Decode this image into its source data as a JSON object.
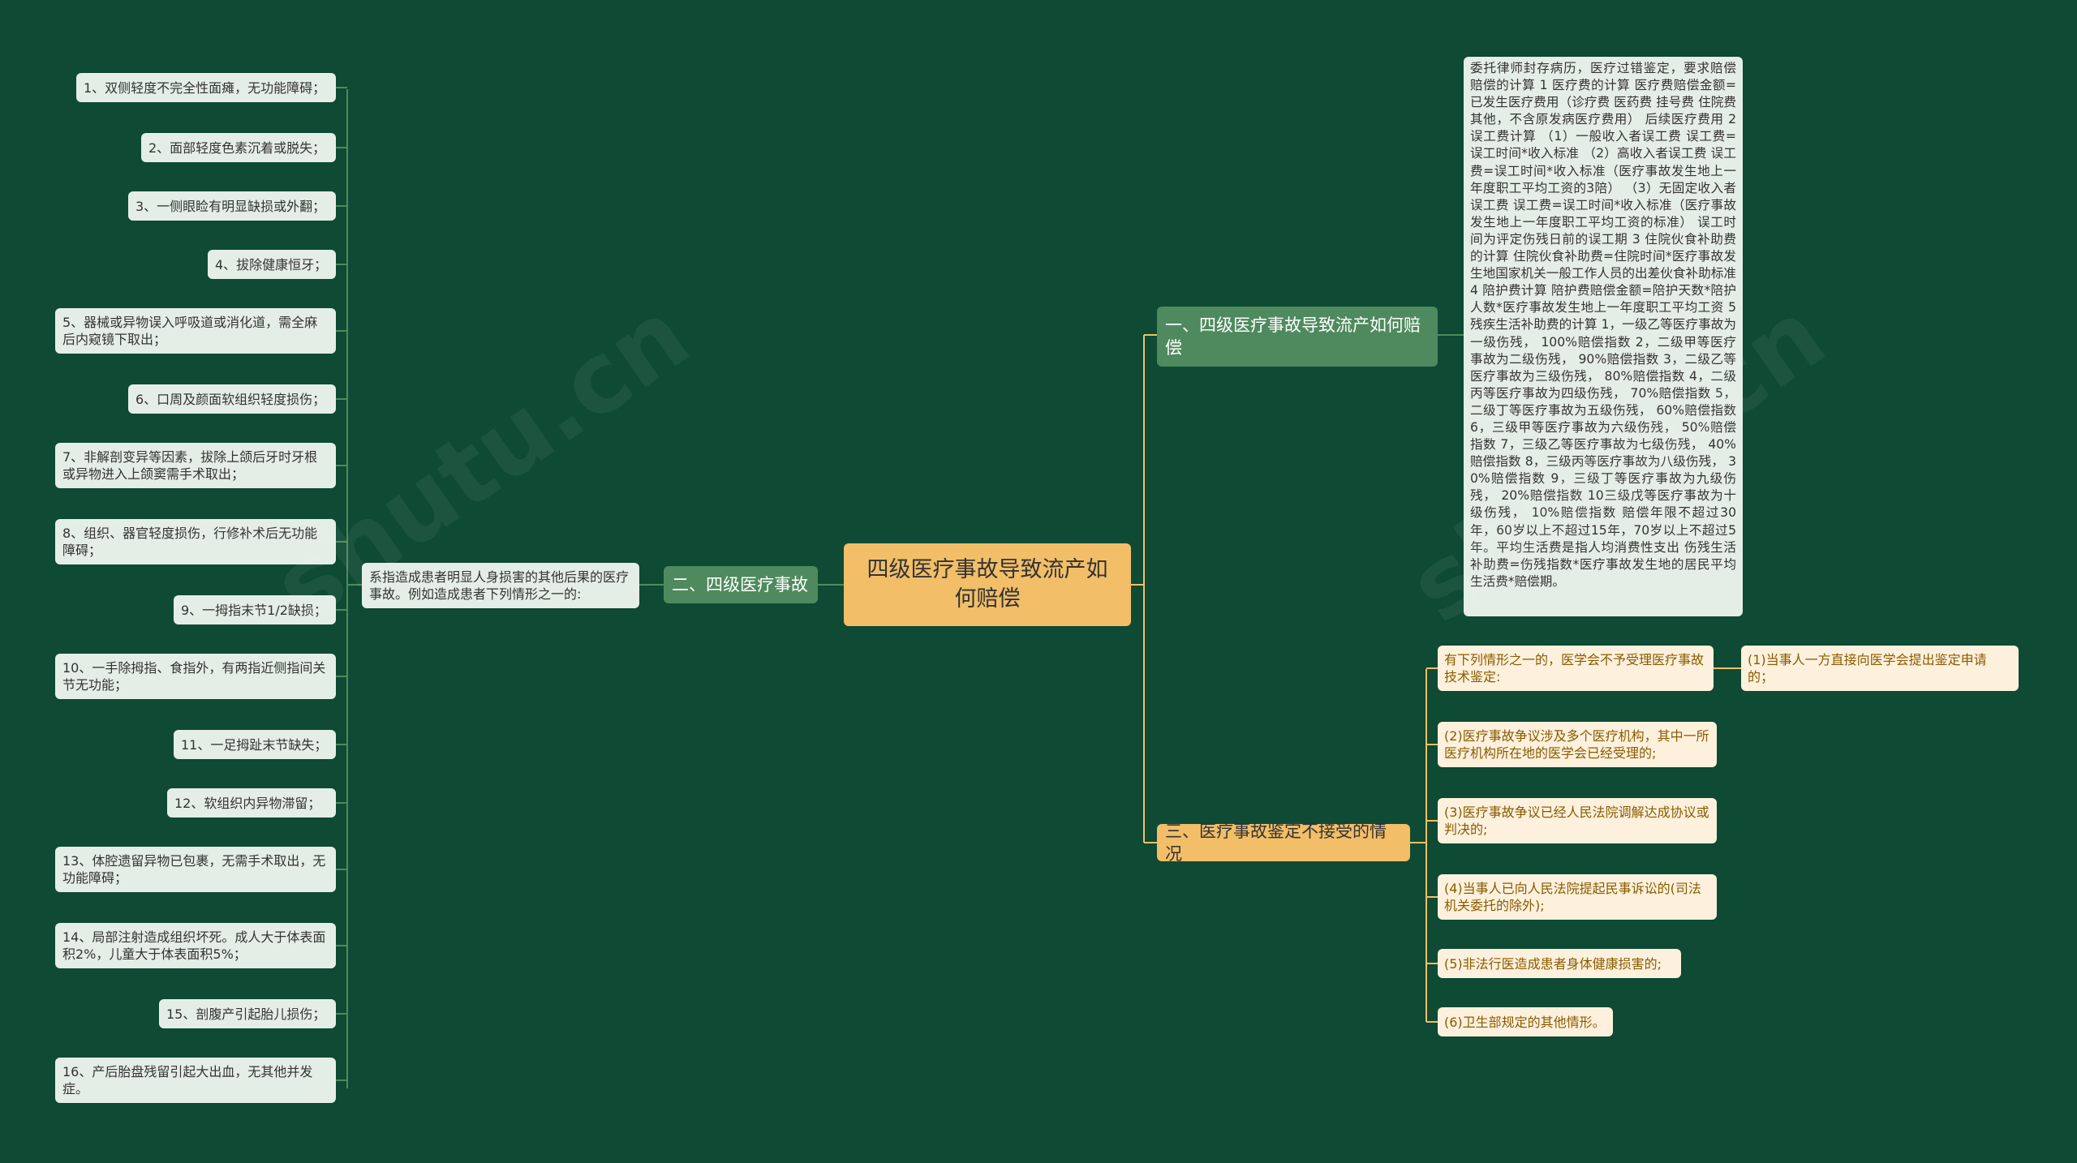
{
  "root": "四级医疗事故导致流产如何赔偿",
  "branch1": {
    "title": "一、四级医疗事故导致流产如何赔偿",
    "detail": "委托律师封存病历，医疗过错鉴定，要求赔偿 赔偿的计算 1 医疗费的计算 医疗费赔偿金额=已发生医疗费用（诊疗费 医药费 挂号费 住院费 其他，不含原发病医疗费用） 后续医疗费用 2 误工费计算 （1）一般收入者误工费 误工费=误工时间*收入标准 （2）高收入者误工费 误工费=误工时间*收入标准（医疗事故发生地上一年度职工平均工资的3陪） （3）无固定收入者误工费 误工费=误工时间*收入标准（医疗事故发生地上一年度职工平均工资的标准） 误工时间为评定伤残日前的误工期 3 住院伙食补助费的计算 住院伙食补助费=住院时间*医疗事故发生地国家机关一般工作人员的出差伙食补助标准 4 陪护费计算 陪护费赔偿金额=陪护天数*陪护人数*医疗事故发生地上一年度职工平均工资 5 残疾生活补助费的计算 1，一级乙等医疗事故为一级伤残， 100%赔偿指数 2，二级甲等医疗事故为二级伤残， 90%赔偿指数 3，二级乙等医疗事故为三级伤残， 80%赔偿指数 4，二级丙等医疗事故为四级伤残， 70%赔偿指数 5，二级丁等医疗事故为五级伤残， 60%赔偿指数 6，三级甲等医疗事故为六级伤残， 50%赔偿指数 7，三级乙等医疗事故为七级伤残， 40%赔偿指数 8，三级丙等医疗事故为八级伤残， 30%赔偿指数 9，三级丁等医疗事故为九级伤残， 20%赔偿指数 10三级戊等医疗事故为十级伤残， 10%赔偿指数 赔偿年限不超过30年，60岁以上不超过15年，70岁以上不超过5年。平均生活费是指人均消费性支出 伤残生活补助费=伤残指数*医疗事故发生地的居民平均生活费*赔偿期。"
  },
  "branch2": {
    "title": "二、四级医疗事故",
    "intro": "系指造成患者明显人身损害的其他后果的医疗事故。例如造成患者下列情形之一的:",
    "items": [
      "1、双侧轻度不完全性面瘫，无功能障碍；",
      "2、面部轻度色素沉着或脱失；",
      "3、一侧眼睑有明显缺损或外翻；",
      "4、拔除健康恒牙；",
      "5、器械或异物误入呼吸道或消化道，需全麻后内窥镜下取出；",
      "6、口周及颜面软组织轻度损伤；",
      "7、非解剖变异等因素，拔除上颌后牙时牙根或异物进入上颌窦需手术取出；",
      "8、组织、器官轻度损伤，行修补术后无功能障碍；",
      "9、一拇指末节1/2缺损；",
      "10、一手除拇指、食指外，有两指近侧指间关节无功能；",
      "11、一足拇趾末节缺失；",
      "12、软组织内异物滞留；",
      "13、体腔遗留异物已包裹，无需手术取出，无功能障碍；",
      "14、局部注射造成组织坏死。成人大于体表面积2%，儿童大于体表面积5%；",
      "15、剖腹产引起胎儿损伤；",
      "16、产后胎盘残留引起大出血，无其他并发症。"
    ]
  },
  "branch3": {
    "title": "三、医疗事故鉴定不接受的情况",
    "intro": "有下列情形之一的，医学会不予受理医疗事故技术鉴定:",
    "intro_child": "(1)当事人一方直接向医学会提出鉴定申请的；",
    "items": [
      "(2)医疗事故争议涉及多个医疗机构，其中一所医疗机构所在地的医学会已经受理的;",
      "(3)医疗事故争议已经人民法院调解达成协议或判决的;",
      "(4)当事人已向人民法院提起民事诉讼的(司法机关委托的除外);",
      "(5)非法行医造成患者身体健康损害的;",
      "(6)卫生部规定的其他情形。"
    ]
  },
  "colors": {
    "background": "#0e4a34",
    "root": "#f2be67",
    "green_branch": "#4e8a5d",
    "orange_branch": "#f2be67",
    "leaf": "#e5eee6",
    "orange_leaf": "#fdf1dd"
  }
}
